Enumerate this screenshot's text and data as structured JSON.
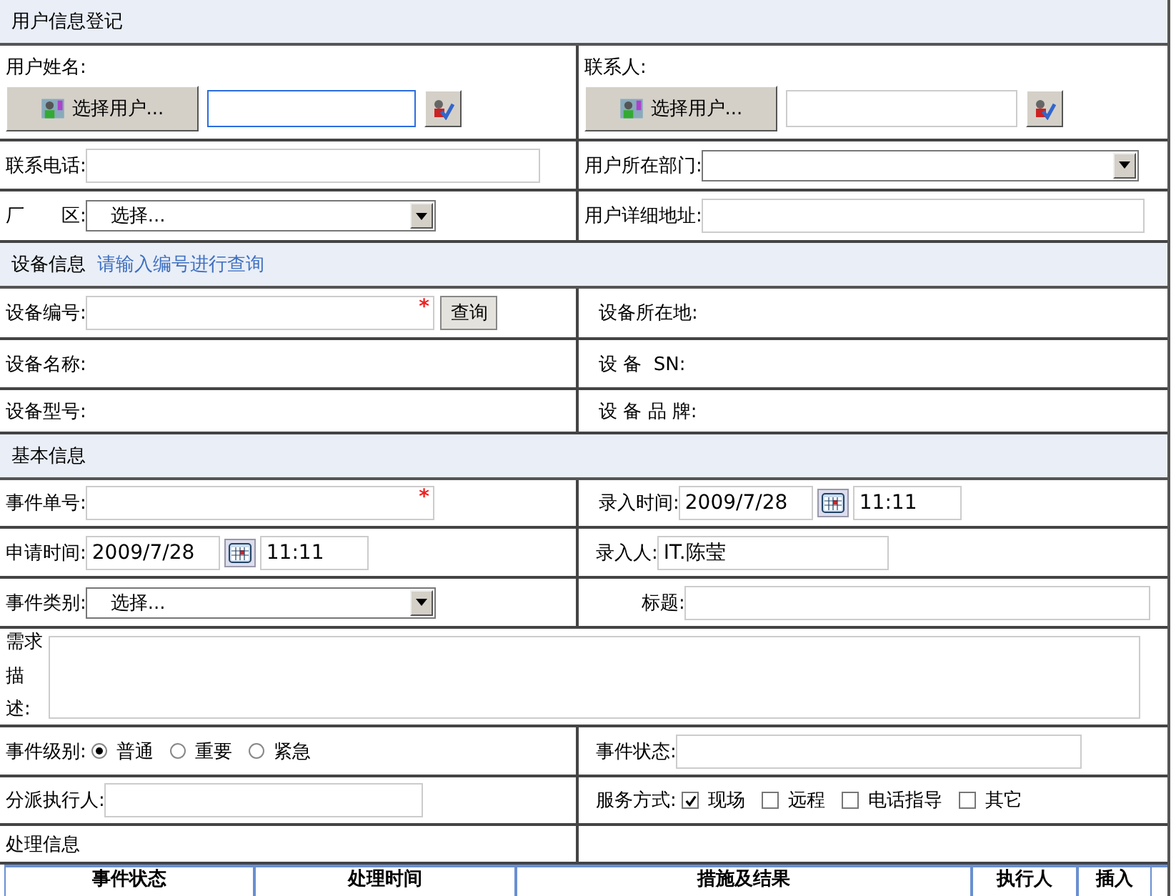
{
  "user_info": {
    "title": "用户信息登记",
    "user_name": {
      "label": "用户姓名:",
      "button": "选择用户...",
      "focused": true
    },
    "contact": {
      "label": "联系人:",
      "button": "选择用户...",
      "focused": false
    },
    "phone": {
      "label": "联系电话:"
    },
    "department": {
      "label": "用户所在部门:"
    },
    "factory": {
      "label": "厂　　区:",
      "value": "选择..."
    },
    "address": {
      "label": "用户详细地址:"
    }
  },
  "device_info": {
    "title": "设备信息",
    "hint": "请输入编号进行查询",
    "number": {
      "label": "设备编号:",
      "required_mark": "*",
      "button": "查询"
    },
    "location": "设备所在地:",
    "name": "设备名称:",
    "sn": "设 备  SN:",
    "model": "设备型号:",
    "brand": "设 备 品 牌:"
  },
  "basic_info": {
    "title": "基本信息",
    "event_no": {
      "label": "事件单号:",
      "required_mark": "*"
    },
    "entry_time": {
      "label": "录入时间:",
      "date": "2009/7/28",
      "time": "11:11"
    },
    "request_time": {
      "label": "申请时间:",
      "date": "2009/7/28",
      "time": "11:11"
    },
    "entered_by": {
      "label": "录入人:",
      "value": "IT.陈莹"
    },
    "category": {
      "label": "事件类别:",
      "value": "选择..."
    },
    "title_field": {
      "label": "标题:"
    },
    "description": {
      "label": "需求描述:"
    },
    "level": {
      "label": "事件级别:",
      "options": [
        {
          "label": "普通",
          "selected": true
        },
        {
          "label": "重要",
          "selected": false
        },
        {
          "label": "紧急",
          "selected": false
        }
      ]
    },
    "status": {
      "label": "事件状态:"
    },
    "assignee": {
      "label": "分派执行人:"
    },
    "service": {
      "label": "服务方式:",
      "options": [
        {
          "label": "现场",
          "checked": true
        },
        {
          "label": "远程",
          "checked": false
        },
        {
          "label": "电话指导",
          "checked": false
        },
        {
          "label": "其它",
          "checked": false
        }
      ]
    }
  },
  "processing": {
    "title": "处理信息",
    "columns": [
      "事件状态",
      "处理时间",
      "措施及结果",
      "执行人",
      "插入"
    ]
  }
}
